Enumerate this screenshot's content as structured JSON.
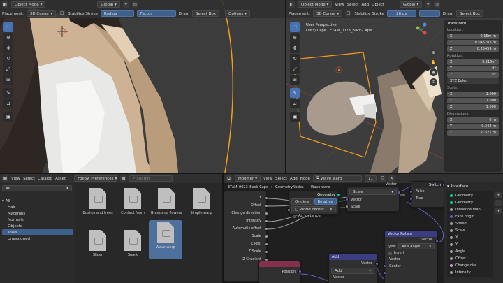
{
  "colors": {
    "accent": "#4772b3",
    "selection_orange": "#f29e1d",
    "socket_geometry": "#00d6a3",
    "socket_vector": "#6363c7",
    "socket_float": "#a1a1a1",
    "node_header_vector": "#3c3c83",
    "node_header_input": "#83314a"
  },
  "left_viewport": {
    "header": {
      "mode": "Object Mode",
      "orientation": "Global",
      "placement_label": "Placement:",
      "placement_value": "3D Cursor",
      "stabilize": "Stabilize Stroke",
      "radius_label": "Radius",
      "strength_label": "Factor",
      "drag_label": "Drag:",
      "drag_value": "Select Box",
      "options": "Options"
    }
  },
  "right_viewport": {
    "header": {
      "mode": "Object Mode",
      "menus": [
        "View",
        "Select",
        "Add",
        "Object"
      ],
      "orientation": "Global",
      "placement_label": "Placement:",
      "placement_value": "3D Cursor",
      "stabilize": "Stabilize Stroke",
      "radius_value": "26 px",
      "drag_label": "Drag:",
      "drag_value": "Select Box"
    },
    "overlay_line1": "User Perspective",
    "overlay_line2": "(163) Cape | ETAM_0023_Back-Cape",
    "n_panel": {
      "tab": "Transform",
      "location_label": "Location:",
      "location": [
        {
          "axis": "X",
          "value": "0.15m m"
        },
        {
          "axis": "Y",
          "value": "0.045782 m"
        },
        {
          "axis": "Z",
          "value": "0.25459 m"
        }
      ],
      "rotation_label": "Rotation:",
      "rotation": [
        {
          "axis": "X",
          "value": "3.215e°"
        },
        {
          "axis": "Y",
          "value": "-0°"
        },
        {
          "axis": "Z",
          "value": "0°"
        }
      ],
      "rotation_mode": "XYZ Euler",
      "scale_label": "Scale:",
      "scale": [
        {
          "axis": "X",
          "value": "1.000"
        },
        {
          "axis": "Y",
          "value": "1.000"
        },
        {
          "axis": "Z",
          "value": "1.000"
        }
      ],
      "dimensions_label": "Dimensions:",
      "dimensions": [
        {
          "axis": "X",
          "value": "0 m"
        },
        {
          "axis": "Y",
          "value": "0.342 m"
        },
        {
          "axis": "Z",
          "value": "0.521 m"
        }
      ]
    }
  },
  "asset_browser": {
    "menus": [
      "View",
      "Select",
      "Catalog",
      "Asset"
    ],
    "filter": "All",
    "library": "Follow Preferences",
    "search_placeholder": "Search",
    "tree_root": "All",
    "tree": [
      {
        "label": "Hair",
        "selected": false
      },
      {
        "label": "Materials",
        "selected": false
      },
      {
        "label": "Normals",
        "selected": false
      },
      {
        "label": "Objects",
        "selected": false
      },
      {
        "label": "Tools",
        "selected": true
      },
      {
        "label": "Unassigned",
        "selected": false
      }
    ],
    "assets": [
      {
        "label": "Bushes and trees",
        "selected": false
      },
      {
        "label": "Contact foam",
        "selected": false
      },
      {
        "label": "Grass and flowers",
        "selected": false
      },
      {
        "label": "Simple warp",
        "selected": false
      },
      {
        "label": "Slider",
        "selected": false
      },
      {
        "label": "Spark",
        "selected": false
      },
      {
        "label": "Wave warp",
        "selected": true
      }
    ]
  },
  "node_editor": {
    "header": {
      "editor_type": "Modifier",
      "menus": [
        "View",
        "Select",
        "Add",
        "Node"
      ],
      "node_group": "Wave warp",
      "users": "11"
    },
    "breadcrumb": {
      "object": "ETAM_0023_Back-Cape",
      "modifier": "GeometryNodes",
      "group": "Wave warp"
    },
    "group_input_sockets": [
      "Y",
      "Offset",
      "Change direction",
      "Intensity",
      "Automatic offset",
      "Scale",
      "Z Pos.",
      "Z Scale",
      "Z Gradient"
    ],
    "object_info": {
      "title": "Geometry",
      "original": "Original",
      "relative": "Relative",
      "world_center": "World center",
      "as_instance": "As Instance"
    },
    "scale_node": {
      "mode": "Scale",
      "out_label": "Vector",
      "vector": "Vector",
      "scale": "Scale"
    },
    "switch_node": {
      "title": "Switch",
      "false": "False",
      "true": "True"
    },
    "vector_rotate": {
      "title": "Vector Rotate",
      "vector_out": "Vector",
      "type_label": "Type:",
      "type_value": "Axis Angle",
      "invert": "Invert",
      "vector_in": "Vector",
      "center": "Center"
    },
    "add_node": {
      "title": "Add",
      "vector_out": "Vector",
      "mode": "Add",
      "vector_in": "Vector"
    },
    "position_node": {
      "title": "Position"
    },
    "interface": {
      "tab": "Interface",
      "items": [
        {
          "label": "Geometry",
          "color": "#00d6a3"
        },
        {
          "label": "Geometry",
          "color": "#00d6a3"
        },
        {
          "label": "Influence map",
          "color": "#a1a1a1"
        },
        {
          "label": "Fake origin",
          "color": "#6363c7"
        },
        {
          "label": "Speed",
          "color": "#a1a1a1"
        },
        {
          "label": "Scale",
          "color": "#a1a1a1"
        },
        {
          "label": "X",
          "color": "#a1a1a1"
        },
        {
          "label": "Y",
          "color": "#a1a1a1"
        },
        {
          "label": "Angle",
          "color": "#a1a1a1"
        },
        {
          "label": "Offset",
          "color": "#a1a1a1"
        },
        {
          "label": "Change dire...",
          "color": "#cca6d6"
        },
        {
          "label": "Intensity",
          "color": "#a1a1a1"
        }
      ]
    }
  }
}
